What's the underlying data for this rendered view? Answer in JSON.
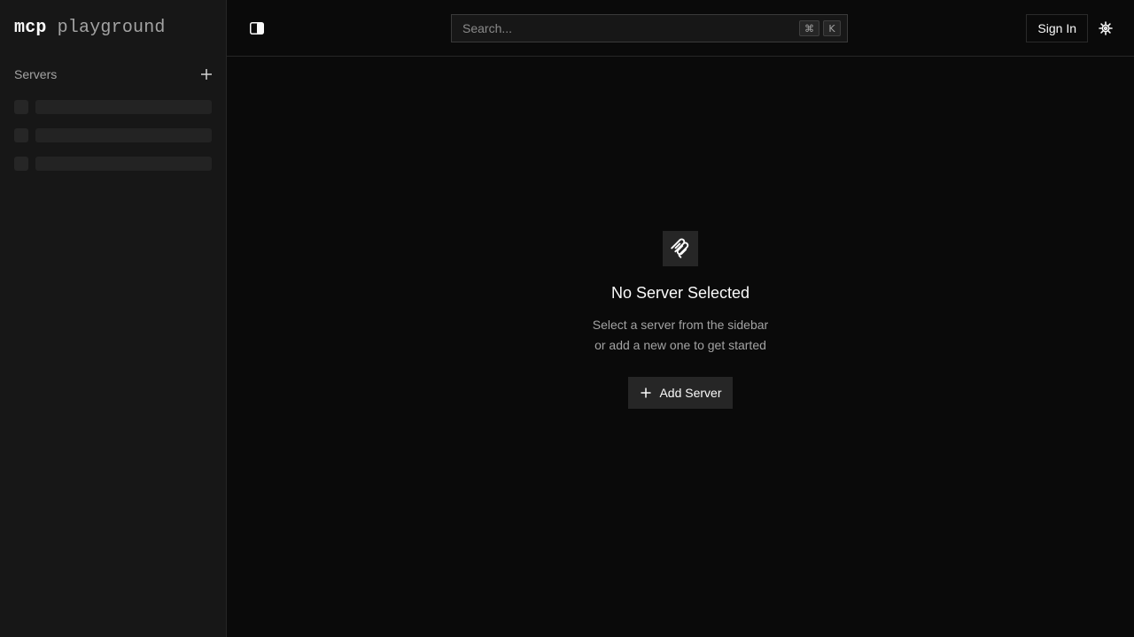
{
  "brand": {
    "primary": "mcp",
    "secondary": "playground"
  },
  "sidebar": {
    "section_label": "Servers",
    "add_icon": "plus-icon",
    "skeleton_rows": 3
  },
  "header": {
    "toggle_icon": "sidebar-toggle-icon",
    "search": {
      "placeholder": "Search...",
      "shortcut_modifier": "⌘",
      "shortcut_key": "K"
    },
    "sign_in_label": "Sign In",
    "settings_icon": "gear-icon"
  },
  "empty_state": {
    "icon": "mcp-logo-icon",
    "title": "No Server Selected",
    "line1": "Select a server from the sidebar",
    "line2": "or add a new one to get started",
    "button_label": "Add Server"
  },
  "colors": {
    "background": "#0a0a0a",
    "sidebar": "#171717",
    "border": "#262626",
    "muted_text": "#a3a3a3",
    "text": "#fafafa"
  }
}
